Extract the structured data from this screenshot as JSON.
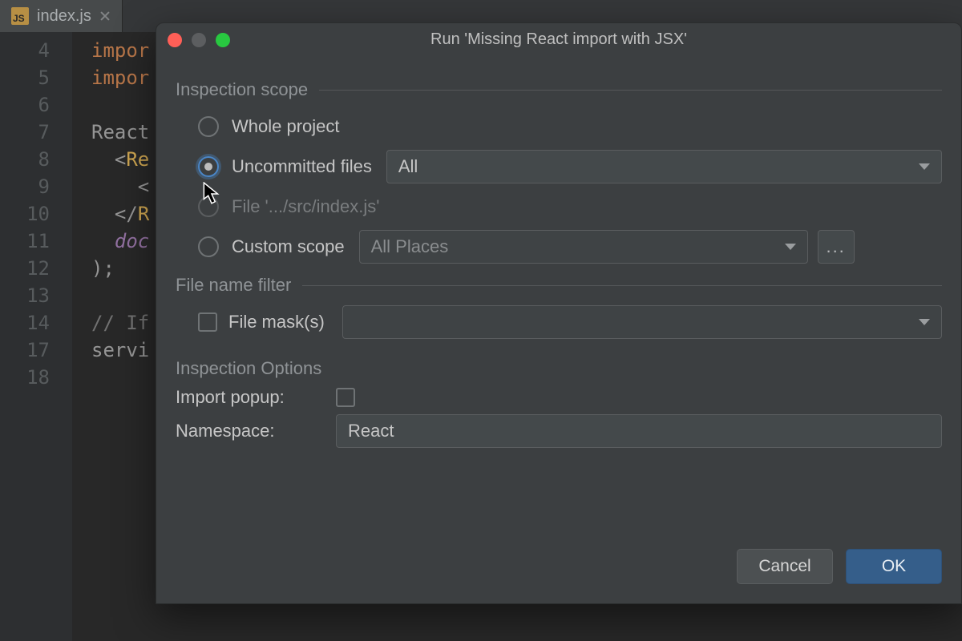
{
  "editor": {
    "tab": {
      "filename": "index.js",
      "file_icon": "JS"
    },
    "line_numbers": [
      "4",
      "5",
      "6",
      "7",
      "8",
      "9",
      "10",
      "11",
      "12",
      "13",
      "14",
      "17",
      "18"
    ],
    "fragments": {
      "l0_k": "impor",
      "l1_k": "impor",
      "l3_ident": "React",
      "l4_open": "<",
      "l4_tag": "Re",
      "l5": "<",
      "l6_open": "</",
      "l6_tag": "R",
      "l7": "doc",
      "l8": ");",
      "l10": "// If",
      "l11": "servi"
    }
  },
  "dialog": {
    "title": "Run 'Missing React import with JSX'",
    "sections": {
      "scope": {
        "heading": "Inspection scope",
        "whole_project": "Whole project",
        "uncommitted": "Uncommitted files",
        "uncommitted_select": "All",
        "file": "File '.../src/index.js'",
        "custom": "Custom scope",
        "custom_select": "All Places",
        "ellipsis": "..."
      },
      "filter": {
        "heading": "File name filter",
        "mask_label": "File mask(s)",
        "mask_value": ""
      },
      "options": {
        "heading": "Inspection Options",
        "import_popup_label": "Import popup:",
        "namespace_label": "Namespace:",
        "namespace_value": "React"
      }
    },
    "buttons": {
      "cancel": "Cancel",
      "ok": "OK"
    }
  }
}
